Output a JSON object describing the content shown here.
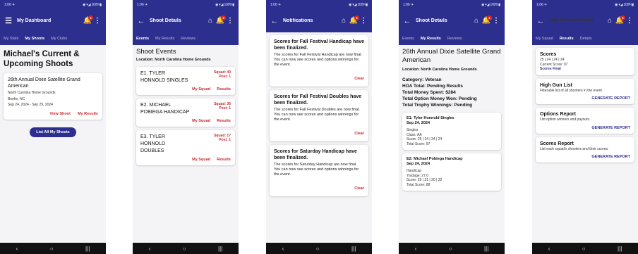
{
  "status_bar": {
    "time": "1:06 ✈",
    "icons": "◉ ▾◢ 100%▮"
  },
  "nav_buttons": {
    "back": "‹",
    "home": "○",
    "recents": "|||"
  },
  "colors": {
    "primary": "#2d2f8f",
    "accent_red": "#c9262d",
    "badge": "#d62929"
  },
  "icons": {
    "menu": "menu-icon",
    "back": "arrow-back-icon",
    "home": "home-icon",
    "bell": "bell-icon",
    "more": "more-vert-icon"
  },
  "screen1": {
    "app_title": "My Dashboard",
    "badge": "9",
    "tabs": [
      "My Stats",
      "My Shoots",
      "My Clubs"
    ],
    "heading": "Michael's Current & Upcoming Shoots",
    "card": {
      "title": "26th Annual Dixie Satellite Grand American",
      "location": "North Carolina Home Grounds",
      "city": "Boeke, NC",
      "dates": "Sep 24, 2024 - Sep 29, 2024",
      "view_shoot": "View Shoot",
      "my_results": "My Results"
    },
    "list_all": "List All My Shoots"
  },
  "screen2": {
    "app_title": "Shoot Details",
    "badge": "9",
    "tabs": [
      "Events",
      "My Results",
      "Reviews"
    ],
    "heading": "Shoot Events",
    "location": "Location: North Carolina Home Grounds",
    "events": [
      {
        "name": "E1. TYLER HONNOLD SINGLES",
        "squad": "Squad: 40",
        "post": "Post: 1",
        "my_squad": "My Squad",
        "results": "Results"
      },
      {
        "name": "E2. MICHAEL POBIEGA HANDICAP",
        "squad": "Squad: 36",
        "post": "Post: 1",
        "my_squad": "My Squad",
        "results": "Results"
      },
      {
        "name": "E3. TYLER HONNOLD DOUBLES",
        "squad": "Squad: 17",
        "post": "Post: 1",
        "my_squad": "My Squad",
        "results": "Results"
      }
    ]
  },
  "screen3": {
    "app_title": "Notifications",
    "badge": "9",
    "notifications": [
      {
        "title": "Scores for Fall Festival Handicap have been finalized.",
        "body": "The scores for Fall Festival Handicap are now final. You can now see scores and options winnings for the event.",
        "clear": "Clear"
      },
      {
        "title": "Scores for Fall Festival Doubles have been finalized.",
        "body": "The scores for Fall Festival Doubles are now final. You can now see scores and options winnings for the event.",
        "clear": "Clear"
      },
      {
        "title": "Scores for Saturday Handicap have been finalized.",
        "body": "The scores for Saturday Handicap are now final. You can now see scores and options winnings for the event.",
        "clear": "Clear"
      }
    ]
  },
  "screen4": {
    "app_title": "Shoot Details",
    "badge": "9",
    "tabs": [
      "Events",
      "My Results",
      "Reviews"
    ],
    "heading": "26th Annual Dixie Satellite Grand American",
    "location": "Location: North Carolina Home Grounds",
    "stats": {
      "category": "Category: Veteran",
      "hoa": "HOA Total: Pending Results",
      "spent": "Total Money Spent: $284",
      "option_won": "Total Option Money Won: Pending",
      "trophy": "Total Trophy Winnings: Pending"
    },
    "results": [
      {
        "title": "E1: Tyler Honnold Singles",
        "date": "Sep 24, 2024",
        "line1": "Singles",
        "line2": "Class: AA",
        "line3": "Score: 25 | 24 | 24 | 24",
        "line4": "Total Score: 97"
      },
      {
        "title": "E2: Michael Pobiega Handicap",
        "date": "Sep 24, 2024",
        "line1": "Handicap",
        "line2": "Yardage: 27.0",
        "line3": "Score: 25 | 21 | 20 | 22",
        "line4": "Total Score: 88"
      }
    ]
  },
  "screen5": {
    "app_title": "Tyler Honnold Singles",
    "badge": "9",
    "tabs": [
      "My Squad",
      "Results",
      "Details"
    ],
    "scores": {
      "title": "Scores",
      "values": "25 | 24 | 24 | 24",
      "current": "Current Score: 97",
      "final": "Scores Final"
    },
    "high_gun": {
      "title": "High Gun List",
      "desc": "Filterable list of all shooters in the event.",
      "action": "GENERATE REPORT"
    },
    "options": {
      "title": "Options Report",
      "desc": "List option winners and payouts.",
      "action": "GENERATE REPORT"
    },
    "scores_report": {
      "title": "Scores Report",
      "desc": "List each squad's shooters and their scores.",
      "action": "GENERATE REPORT"
    }
  }
}
